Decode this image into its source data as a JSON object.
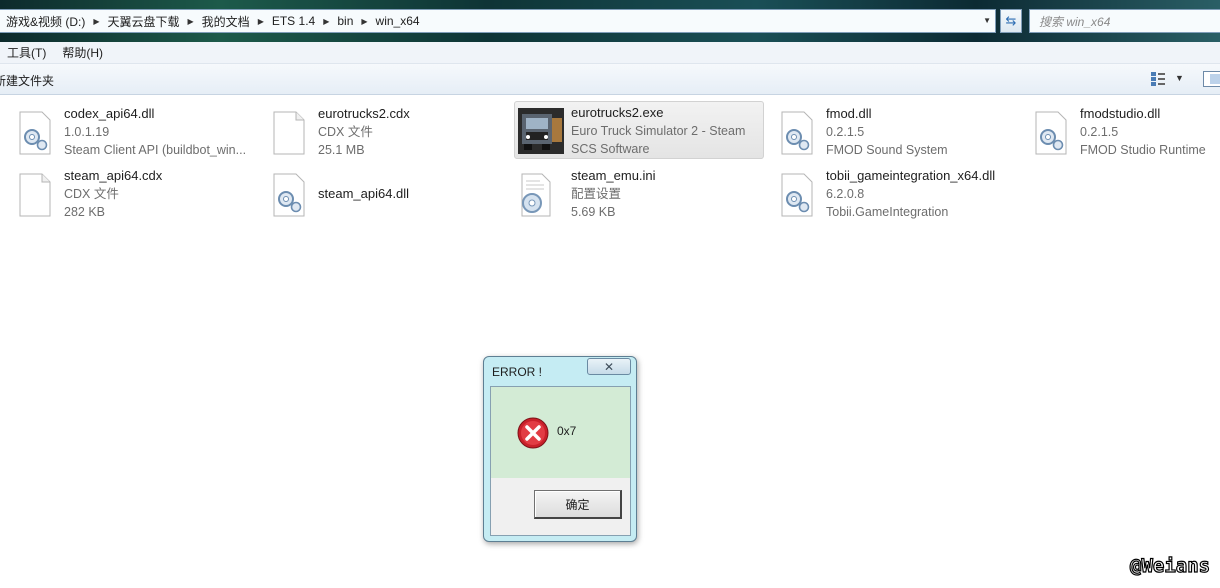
{
  "address_bar": {
    "crumbs": [
      "游戏&视频 (D:)",
      "天翼云盘下载",
      "我的文档",
      "ETS 1.4",
      "bin",
      "win_x64"
    ],
    "search_placeholder": "搜索 win_x64"
  },
  "menu": {
    "items": [
      "工具(T)",
      "帮助(H)"
    ]
  },
  "toolbar": {
    "new_folder": "新建文件夹"
  },
  "files": [
    {
      "name": "codex_api64.dll",
      "line1": "1.0.1.19",
      "line2": "Steam Client API (buildbot_win...",
      "icon": "dll-gear-icon"
    },
    {
      "name": "eurotrucks2.cdx",
      "line1": "CDX 文件",
      "line2": "25.1 MB",
      "icon": "blank-file-icon"
    },
    {
      "name": "eurotrucks2.exe",
      "line1": "Euro Truck Simulator 2 - Steam",
      "line2": "SCS Software",
      "icon": "truck-app-icon"
    },
    {
      "name": "fmod.dll",
      "line1": "0.2.1.5",
      "line2": "FMOD Sound System",
      "icon": "dll-gear-icon"
    },
    {
      "name": "fmodstudio.dll",
      "line1": "0.2.1.5",
      "line2": "FMOD Studio Runtime",
      "icon": "dll-gear-icon"
    },
    {
      "name": "steam_api64.cdx",
      "line1": "CDX 文件",
      "line2": "282 KB",
      "icon": "blank-file-icon"
    },
    {
      "name": "steam_api64.dll",
      "line1": "",
      "line2": "",
      "icon": "dll-gear-icon"
    },
    {
      "name": "steam_emu.ini",
      "line1": "配置设置",
      "line2": "5.69 KB",
      "icon": "ini-settings-icon"
    },
    {
      "name": "tobii_gameintegration_x64.dll",
      "line1": "6.2.0.8",
      "line2": "Tobii.GameIntegration",
      "icon": "dll-gear-icon"
    }
  ],
  "dialog": {
    "title": "ERROR !",
    "close_glyph": "✕",
    "message": "0x7",
    "ok_label": "确定",
    "icon": "error-x-icon"
  },
  "watermark": "@Weians"
}
